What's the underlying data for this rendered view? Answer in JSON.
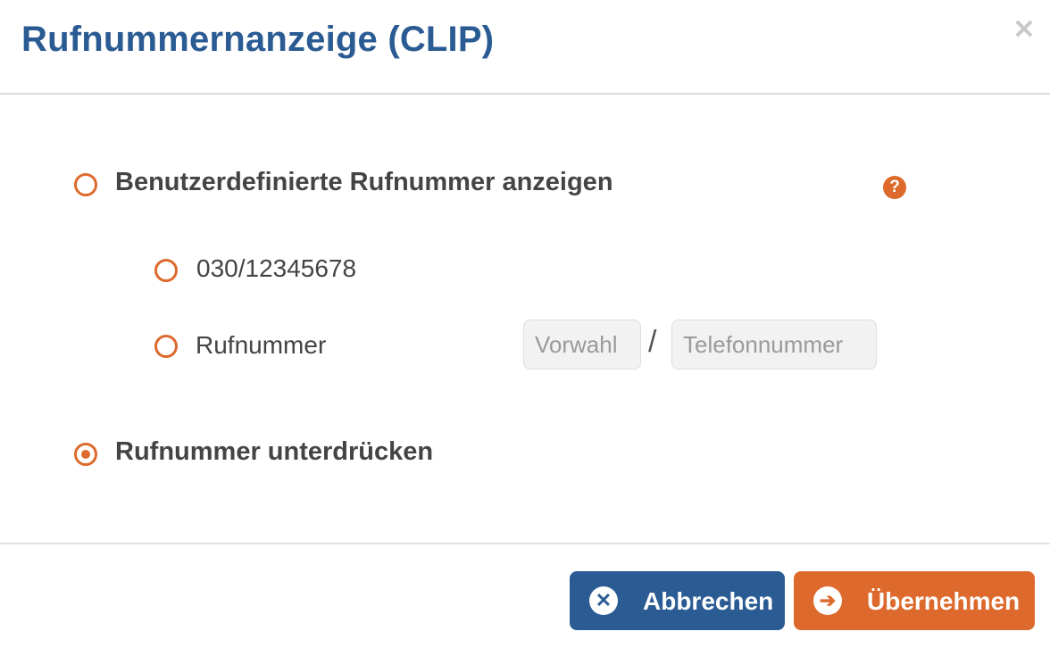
{
  "dialog": {
    "title": "Rufnummernanzeige (CLIP)",
    "close_icon": "close-icon"
  },
  "options": {
    "custom_label": "Benutzerdefinierte Rufnummer anzeigen",
    "custom_checked": false,
    "help_icon": "question-mark-icon",
    "help_glyph": "?",
    "preset_number": "030/12345678",
    "preset_checked": false,
    "manual_label": "Rufnummer",
    "manual_checked": false,
    "suppress_label": "Rufnummer unterdrücken",
    "suppress_checked": true
  },
  "inputs": {
    "area_code_placeholder": "Vorwahl",
    "area_code_value": "",
    "separator": "/",
    "phone_placeholder": "Telefonnummer",
    "phone_value": ""
  },
  "footer": {
    "cancel_label": "Abbrechen",
    "cancel_icon": "x-circle-icon",
    "cancel_glyph": "✕",
    "apply_label": "Übernehmen",
    "apply_icon": "arrow-right-circle-icon",
    "apply_glyph": "➔"
  },
  "colors": {
    "brand_blue": "#2a5b93",
    "accent_orange": "#dd6a2c",
    "text": "#444444"
  }
}
